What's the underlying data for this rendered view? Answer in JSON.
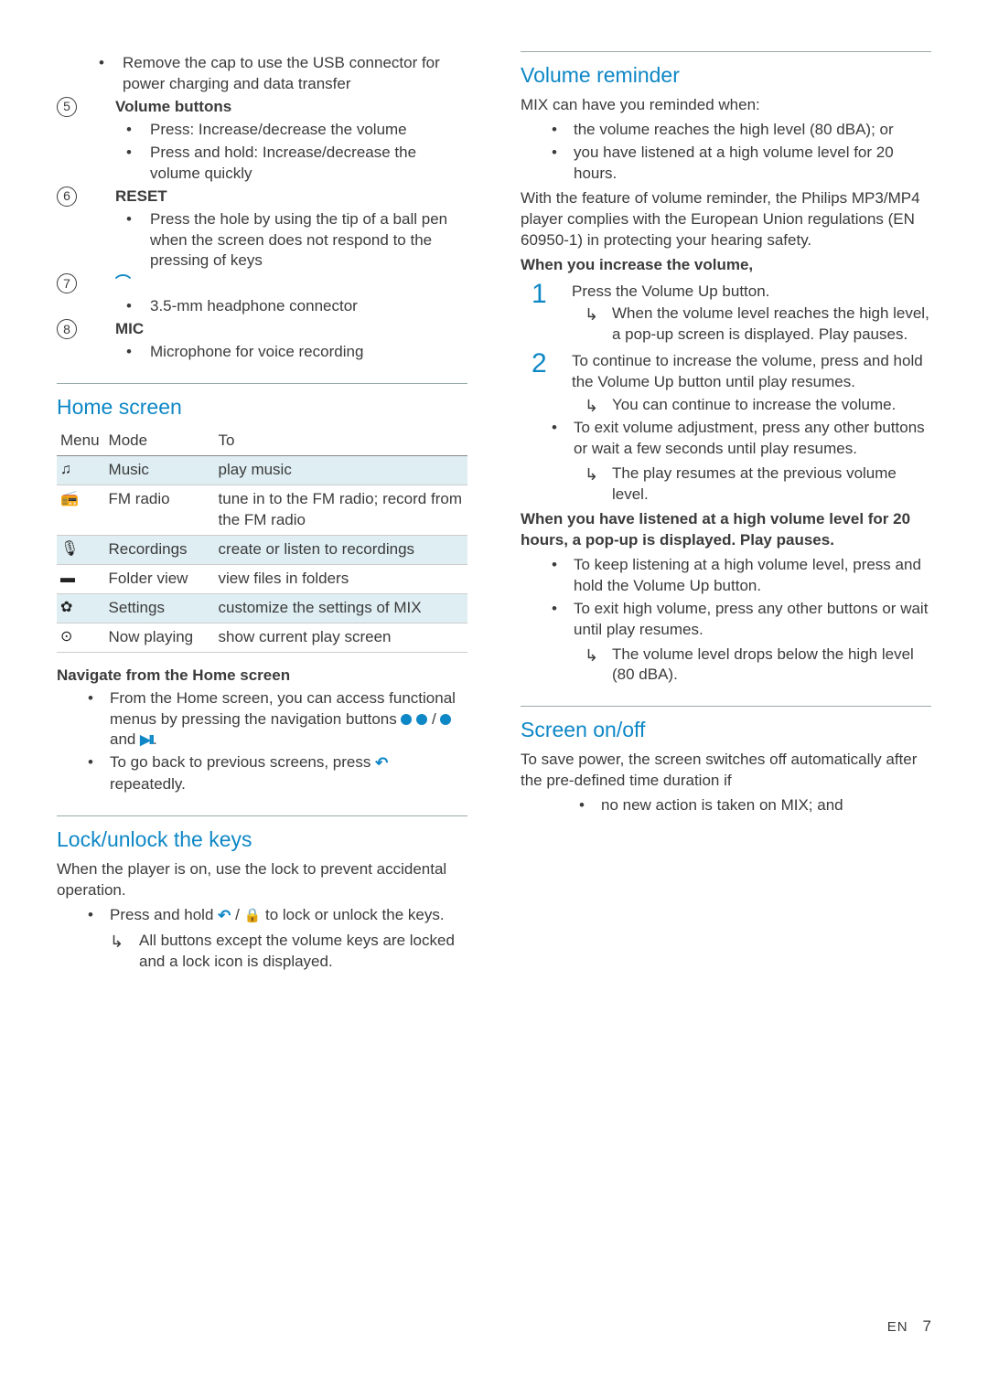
{
  "left": {
    "item4_bullet1": "Remove the cap to use the USB connector for power charging and data transfer",
    "item5_num": "5",
    "item5_title": "Volume buttons",
    "item5_b1": "Press: Increase/decrease the volume",
    "item5_b2": "Press and hold: Increase/decrease the volume quickly",
    "item6_num": "6",
    "item6_title": "RESET",
    "item6_b1": "Press the hole by using the tip of a ball pen when the screen does not respond to the pressing of keys",
    "item7_num": "7",
    "item7_b1": "3.5-mm headphone connector",
    "item8_num": "8",
    "item8_title": "MIC",
    "item8_b1": "Microphone for voice recording",
    "home_title": "Home screen",
    "table": {
      "h1": "Menu",
      "h2": "Mode",
      "h3": "To",
      "rows": [
        {
          "icon": "♫",
          "mode": "Music",
          "to": "play music",
          "shade": true
        },
        {
          "icon": "📻",
          "mode": "FM radio",
          "to": "tune in to the FM radio; record from the FM radio",
          "shade": false
        },
        {
          "icon": "🎙",
          "mode": "Recordings",
          "to": "create or listen to recordings",
          "shade": true
        },
        {
          "icon": "▬",
          "mode": "Folder view",
          "to": "view files in folders",
          "shade": false
        },
        {
          "icon": "✿",
          "mode": "Settings",
          "to": "customize the settings of MIX",
          "shade": true
        },
        {
          "icon": "⊙",
          "mode": "Now playing",
          "to": "show current play screen",
          "shade": false
        }
      ]
    },
    "nav_heading": "Navigate from the Home screen",
    "nav_b1_a": "From the Home screen, you can access functional menus by pressing the navigation buttons ",
    "nav_b1_b": " / ",
    "nav_b1_c": " and ",
    "nav_b1_d": ".",
    "nav_b2_a": "To go back to previous screens, press ",
    "nav_b2_b": " repeatedly.",
    "lock_title": "Lock/unlock the keys",
    "lock_intro": "When the player is on, use the lock to prevent accidental operation.",
    "lock_b1_a": "Press and hold ",
    "lock_b1_b": " / ",
    "lock_b1_c": " to lock or unlock the keys."
  },
  "right": {
    "lock_result": "All buttons except the volume keys are locked and a lock icon is displayed.",
    "vol_title": "Volume reminder",
    "vol_intro": "MIX can have you reminded when:",
    "vol_b1": "the volume reaches the high level (80 dBA); or",
    "vol_b2": "you have listened at a high volume level for 20 hours.",
    "vol_para": "With the feature of volume reminder, the Philips MP3/MP4 player complies with the European Union regulations (EN 60950-1) in protecting your hearing safety.",
    "vol_inc_heading": "When you increase the volume,",
    "step1": "Press the Volume Up button.",
    "step1_res": "When the volume level reaches the high level, a pop-up screen is displayed. Play pauses.",
    "step2": "To continue to increase the volume, press and hold the Volume Up button until play resumes.",
    "step2_res": "You can continue to increase the volume.",
    "vol_b3": "To exit volume adjustment, press any other buttons or wait a few seconds until play resumes.",
    "vol_b3_res": "The play resumes at the previous volume level.",
    "vol_20h": "When you have listened at a high volume level for 20 hours, a pop-up is displayed. Play pauses.",
    "vol_20_b1": "To keep listening at a high volume level, press and hold the Volume Up button.",
    "vol_20_b2": "To exit high volume, press any other buttons or wait until play resumes.",
    "vol_20_b2_res": "The volume level drops below the high level (80 dBA).",
    "screen_title": "Screen on/off",
    "screen_intro": "To save power, the screen switches off automatically after the pre-defined time duration if",
    "screen_b1": "no new action is taken on MIX; and"
  },
  "footer": {
    "lang": "EN",
    "page": "7"
  }
}
